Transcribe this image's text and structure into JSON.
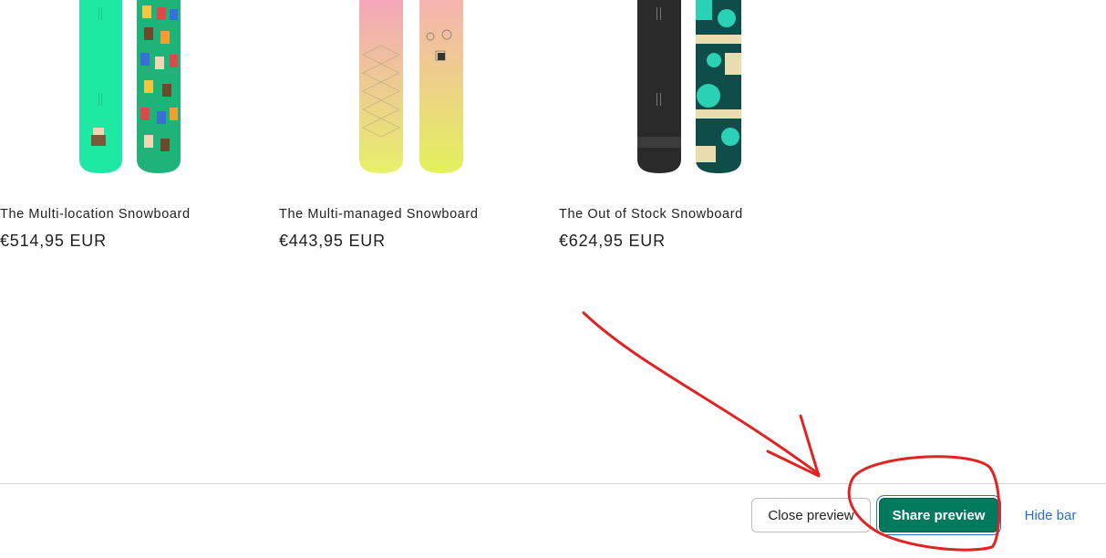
{
  "products": [
    {
      "title": "The Multi-location Snowboard",
      "price": "€514,95 EUR",
      "colors": {
        "board_left": "#1de9a3",
        "board_right": "#1fb37a"
      }
    },
    {
      "title": "The Multi-managed Snowboard",
      "price": "€443,95 EUR",
      "colors": {
        "board_left_top": "#f4a7b9",
        "board_left_bottom": "#e7f06a",
        "board_right_top": "#f6b3b0",
        "board_right_bottom": "#e3f25c"
      }
    },
    {
      "title": "The Out of Stock Snowboard",
      "price": "€624,95 EUR",
      "colors": {
        "board_left": "#2a2a2a",
        "board_right": "#0f4d4a",
        "accent": "#2bd1b4",
        "cream": "#eadcae"
      }
    }
  ],
  "preview_bar": {
    "close_label": "Close preview",
    "share_label": "Share preview",
    "hide_label": "Hide bar"
  },
  "theme": {
    "share_green": "#007a5c",
    "link_blue": "#2c6ecb",
    "annotation_red": "#e02424"
  }
}
